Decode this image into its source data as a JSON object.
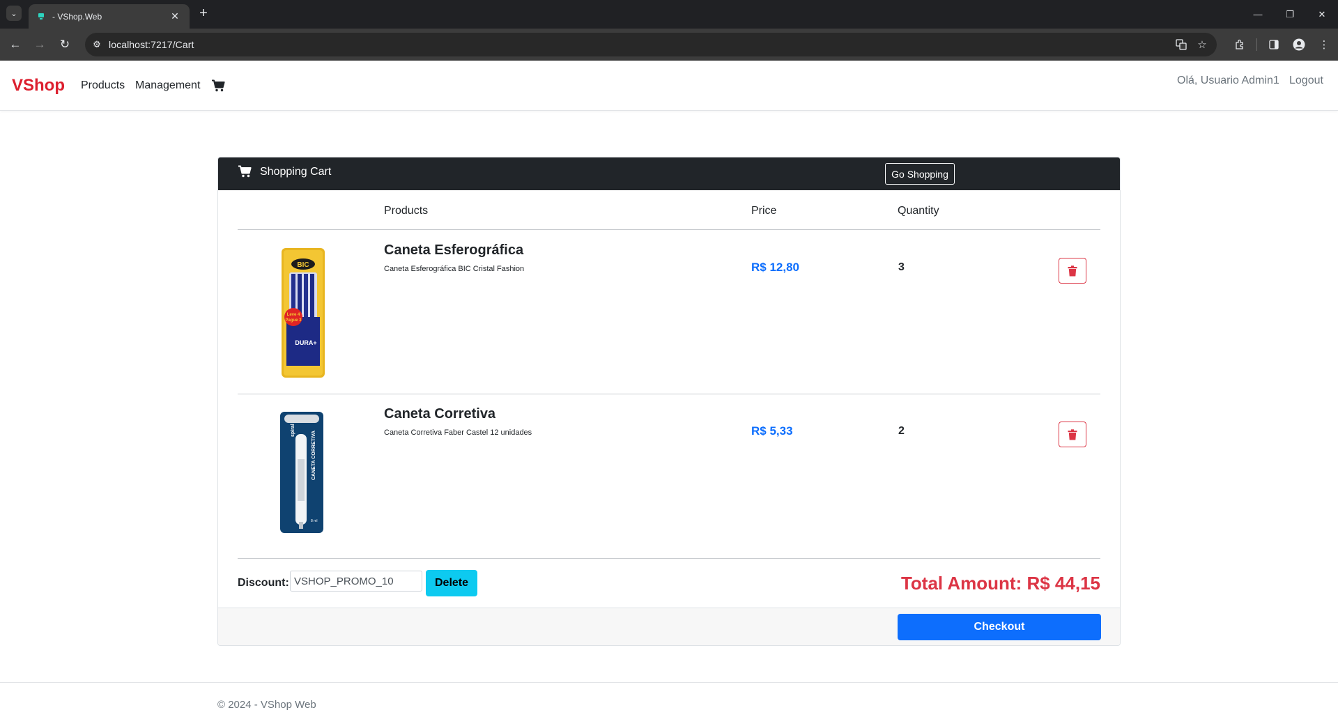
{
  "browser": {
    "tab_title": "- VShop.Web",
    "url": "localhost:7217/Cart",
    "new_tab_symbol": "+",
    "close_symbol": "✕"
  },
  "navbar": {
    "brand": "VShop",
    "links": [
      "Products",
      "Management"
    ],
    "greeting": "Olá, Usuario Admin1",
    "logout": "Logout"
  },
  "cart": {
    "header_title": "Shopping Cart",
    "go_shopping": "Go Shopping",
    "columns": {
      "products": "Products",
      "price": "Price",
      "quantity": "Quantity"
    },
    "items": [
      {
        "name": "Caneta Esferográfica",
        "description": "Caneta Esferográfica BIC Cristal Fashion",
        "price": "R$ 12,80",
        "quantity": "3"
      },
      {
        "name": "Caneta Corretiva",
        "description": "Caneta Corretiva Faber Castel 12 unidades",
        "price": "R$ 5,33",
        "quantity": "2"
      }
    ],
    "discount_label": "Discount:",
    "discount_code": "VSHOP_PROMO_10",
    "discount_delete": "Delete",
    "total": "Total Amount: R$ 44,15",
    "checkout": "Checkout"
  },
  "footer": {
    "text": "© 2024 - VShop Web"
  },
  "colors": {
    "brand": "#dc1f2e",
    "price": "#0d6efd",
    "danger": "#dc3545",
    "info": "#0dcaf0"
  }
}
